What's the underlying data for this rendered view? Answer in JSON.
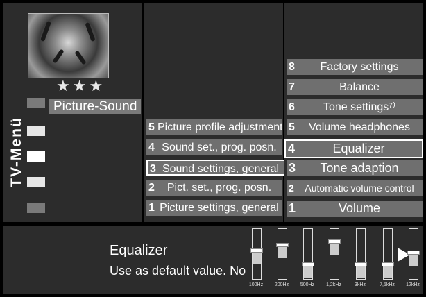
{
  "vertical_title": "TV-Menü",
  "stars": "★★★",
  "main_menu": {
    "picture_sound_label": "Picture-Sound"
  },
  "sound_submenu": [
    {
      "num": "5",
      "label": "Picture profile adjustment"
    },
    {
      "num": "4",
      "label": "Sound set., prog. posn."
    },
    {
      "num": "3",
      "label": "Sound settings, general"
    },
    {
      "num": "2",
      "label": "Pict. set., prog. posn."
    },
    {
      "num": "1",
      "label": "Picture settings, general"
    }
  ],
  "sound_settings_menu": [
    {
      "num": "8",
      "label": "Factory settings"
    },
    {
      "num": "7",
      "label": "Balance"
    },
    {
      "num": "6",
      "label": "Tone settings⁷⁾"
    },
    {
      "num": "5",
      "label": "Volume headphones"
    },
    {
      "num": "4",
      "label": "Equalizer"
    },
    {
      "num": "3",
      "label": "Tone adaption"
    },
    {
      "num": "2",
      "label": "Automatic volume control"
    },
    {
      "num": "1",
      "label": "Volume"
    }
  ],
  "equalizer": {
    "title": "Equalizer",
    "default_text": "Use as default value.  No",
    "bands": [
      {
        "freq": "100Hz",
        "level": 0.58
      },
      {
        "freq": "200Hz",
        "level": 0.7
      },
      {
        "freq": "500Hz",
        "level": 0.3
      },
      {
        "freq": "1,2kHz",
        "level": 0.77
      },
      {
        "freq": "3kHz",
        "level": 0.3
      },
      {
        "freq": "7,5kHz",
        "level": 0.3
      },
      {
        "freq": "12kHz",
        "level": 0.54
      }
    ]
  },
  "colors": {
    "panel": "#2c2c2c",
    "button": "#6f6f6f",
    "highlight": "#ffffff"
  }
}
